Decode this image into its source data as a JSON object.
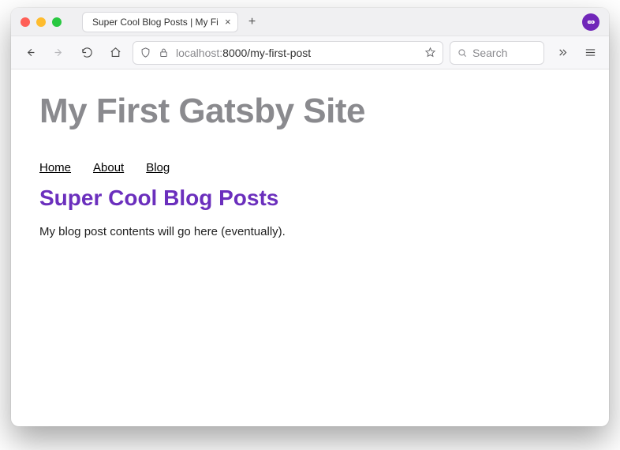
{
  "window": {
    "tab_title": "Super Cool Blog Posts | My First Gat",
    "new_tab_glyph": "+"
  },
  "toolbar": {
    "url_host": "localhost:",
    "url_port_path": "8000/my-first-post",
    "search_placeholder": "Search"
  },
  "page": {
    "site_title": "My First Gatsby Site",
    "nav": {
      "home": "Home",
      "about": "About",
      "blog": "Blog"
    },
    "post_title": "Super Cool Blog Posts",
    "post_body": "My blog post contents will go here (eventually)."
  }
}
